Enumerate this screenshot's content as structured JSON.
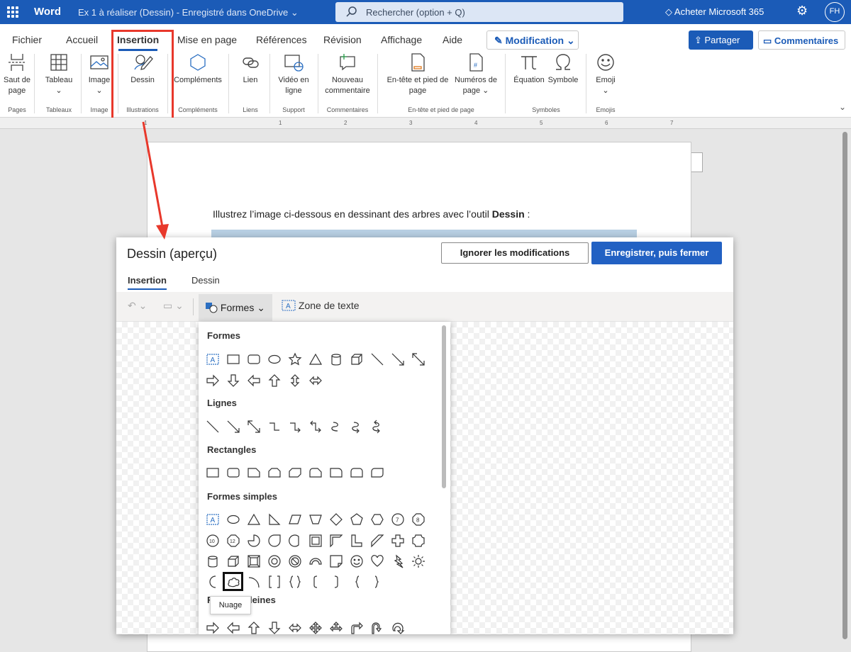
{
  "topbar": {
    "app_name": "Word",
    "doc_title": "Ex 1 à réaliser (Dessin)  -  Enregistré dans OneDrive ⌄",
    "search_placeholder": "Rechercher (option + Q)",
    "buy_label": "Acheter Microsoft 365",
    "avatar": "FH"
  },
  "ribbon": {
    "tabs": [
      "Fichier",
      "Accueil",
      "Insertion",
      "Mise en page",
      "Références",
      "Révision",
      "Affichage",
      "Aide"
    ],
    "active_tab": "Insertion",
    "mode_label": "Modification ⌄",
    "share_label": "Partager",
    "comments_label": "Commentaires",
    "buttons": [
      {
        "l1": "Saut de",
        "l2": "page"
      },
      {
        "l1": "Tableau",
        "l2": "⌄"
      },
      {
        "l1": "Image",
        "l2": "⌄"
      },
      {
        "l1": "Dessin",
        "l2": ""
      },
      {
        "l1": "Compléments",
        "l2": ""
      },
      {
        "l1": "Lien",
        "l2": ""
      },
      {
        "l1": "Vidéo en",
        "l2": "ligne"
      },
      {
        "l1": "Nouveau",
        "l2": "commentaire"
      },
      {
        "l1": "En-tête et pied de",
        "l2": "page"
      },
      {
        "l1": "Numéros de",
        "l2": "page ⌄"
      },
      {
        "l1": "Équation",
        "l2": ""
      },
      {
        "l1": "Symbole",
        "l2": ""
      },
      {
        "l1": "Emoji",
        "l2": "⌄"
      }
    ],
    "groups": [
      "Pages",
      "Tableaux",
      "Image",
      "Illustrations",
      "Compléments",
      "Liens",
      "Support",
      "Commentaires",
      "En-tête et pied de page",
      "Symboles",
      "Emojis"
    ]
  },
  "ruler": [
    "1",
    "1",
    "2",
    "3",
    "4",
    "5",
    "6",
    "7"
  ],
  "page": {
    "instruction_prefix": "Illustrez l’image ci-dessous en dessinant des arbres avec l’outil ",
    "instruction_bold": "Dessin",
    "instruction_suffix": " :"
  },
  "dialog": {
    "title": "Dessin (aperçu)",
    "ignore_label": "Ignorer les modifications",
    "save_label": "Enregistrer, puis fermer",
    "tabs": [
      "Insertion",
      "Dessin"
    ],
    "active_tab": "Insertion",
    "toolbar": {
      "shapes_label": "Formes ⌄",
      "textbox_label": "Zone de texte"
    }
  },
  "shapes_menu": {
    "sections": [
      {
        "heading": "Formes",
        "rows": [
          [
            "textbox",
            "rect",
            "roundrect",
            "ellipse",
            "star",
            "triangle",
            "can",
            "cube",
            "line",
            "arrowline",
            "dblarrowline"
          ],
          [
            "arrow-right",
            "arrow-down",
            "arrow-left",
            "arrow-up",
            "arrow-updown",
            "arrow-leftright"
          ]
        ]
      },
      {
        "heading": "Lignes",
        "rows": [
          [
            "line",
            "arrowline",
            "dblarrowline",
            "elbow",
            "elbowarrow",
            "elbowdbl",
            "curve",
            "curvearrow",
            "curvedbl"
          ]
        ]
      },
      {
        "heading": "Rectangles",
        "rows": [
          [
            "rect",
            "roundrect",
            "snip1",
            "snip2",
            "snipdiag",
            "snipround",
            "round1",
            "round2",
            "rounddiag"
          ]
        ]
      },
      {
        "heading": "Formes simples",
        "rows": [
          [
            "textbox",
            "ellipse",
            "triangle",
            "rtriangle",
            "parallelogram",
            "trapezoid",
            "diamond",
            "pentagon",
            "hexagon",
            "n7",
            "n8"
          ],
          [
            "n10",
            "n12",
            "pie",
            "teardrop",
            "chord",
            "frame",
            "halfframe",
            "lshape",
            "diagstripe",
            "plus",
            "plaque"
          ],
          [
            "can",
            "cube",
            "bevel",
            "donut",
            "nosymbol",
            "blockarc",
            "foldedcorner",
            "smiley",
            "heart",
            "lightning",
            "sun"
          ],
          [
            "moon",
            "cloud",
            "arc",
            "dblbracket",
            "dblbrace",
            "lbracket",
            "rbracket",
            "lbrace",
            "rbrace"
          ]
        ]
      },
      {
        "heading": "Flèches pleines",
        "rows": [
          [
            "arrow-right",
            "arrow-left",
            "arrow-up",
            "arrow-down",
            "arrow-leftright",
            "arrow-4",
            "arrow-3",
            "arrow-bent",
            "arrow-u",
            "arrow-circ"
          ]
        ]
      }
    ],
    "selected": "cloud",
    "tooltip": "Nuage"
  },
  "colors": {
    "accent": "#1b5bb7",
    "highlight": "#e8382b",
    "save": "#2261c3"
  }
}
